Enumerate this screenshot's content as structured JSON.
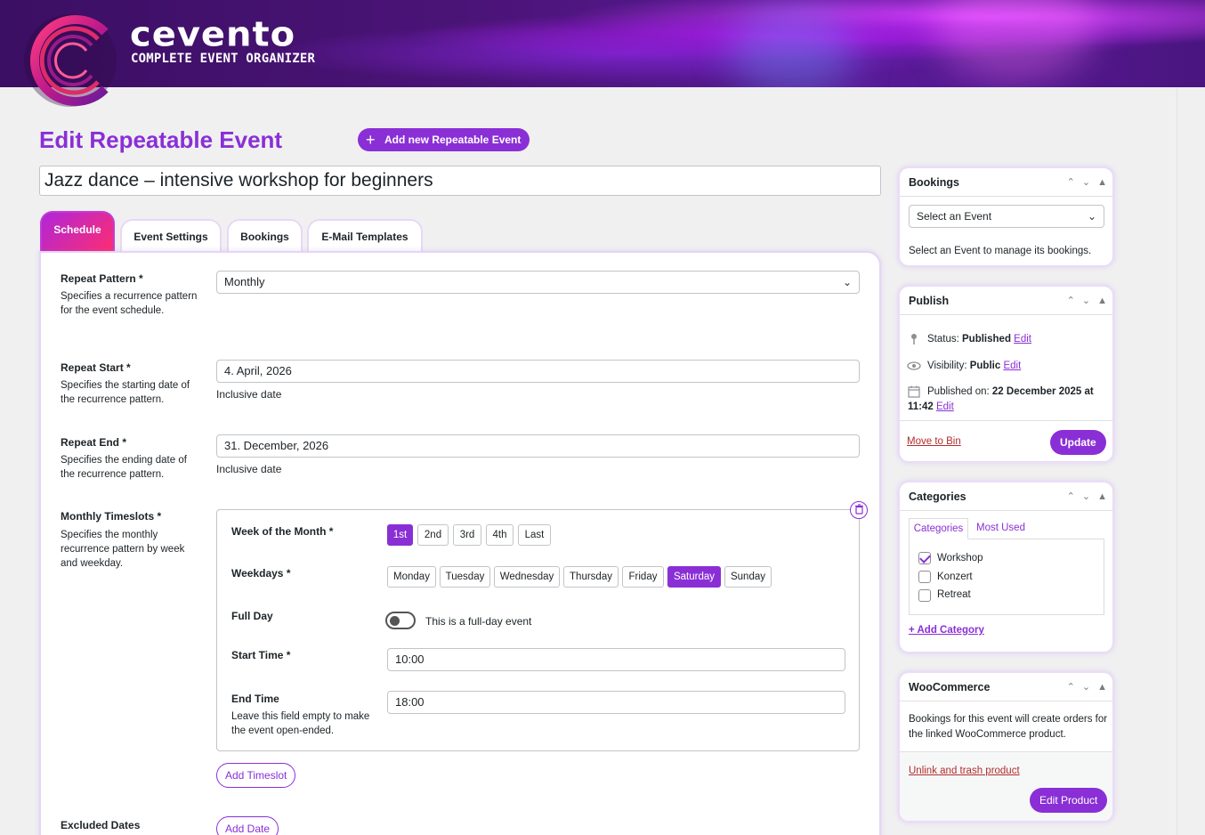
{
  "brand": {
    "name": "cevento",
    "tagline": "COMPLETE EVENT ORGANIZER"
  },
  "colors": {
    "accent": "#8a2fd6",
    "tab_gradient_start": "#b026d9",
    "tab_gradient_end": "#ff2d6f",
    "danger": "#b32d2e"
  },
  "page": {
    "title": "Edit Repeatable Event",
    "add_new_label": "Add new Repeatable Event",
    "event_title": "Jazz dance – intensive workshop for beginners"
  },
  "tabs": [
    {
      "label": "Schedule",
      "active": true
    },
    {
      "label": "Event Settings"
    },
    {
      "label": "Bookings"
    },
    {
      "label": "E-Mail Templates"
    }
  ],
  "schedule": {
    "repeat_pattern": {
      "label": "Repeat Pattern *",
      "desc": "Specifies a recurrence pattern for the event schedule.",
      "value": "Monthly"
    },
    "repeat_start": {
      "label": "Repeat Start *",
      "desc": "Specifies the starting date of the recurrence pattern.",
      "value": "4. April, 2026",
      "hint": "Inclusive date"
    },
    "repeat_end": {
      "label": "Repeat End *",
      "desc": "Specifies the ending date of the recurrence pattern.",
      "value": "31. December, 2026",
      "hint": "Inclusive date"
    },
    "monthly_timeslots": {
      "label": "Monthly Timeslots *",
      "desc": "Specifies the monthly recurrence pattern by week and weekday.",
      "week_label": "Week of the Month *",
      "weeks": [
        "1st",
        "2nd",
        "3rd",
        "4th",
        "Last"
      ],
      "selected_week": "1st",
      "weekdays_label": "Weekdays *",
      "weekdays": [
        "Monday",
        "Tuesday",
        "Wednesday",
        "Thursday",
        "Friday",
        "Saturday",
        "Sunday"
      ],
      "selected_weekday": "Saturday",
      "full_day_label": "Full Day",
      "full_day_text": "This is a full-day event",
      "start_time_label": "Start Time *",
      "start_time": "10:00",
      "end_time_label": "End Time",
      "end_time_desc": "Leave this field empty to make the event open-ended.",
      "end_time": "18:00",
      "add_timeslot_label": "Add Timeslot"
    },
    "excluded_dates": {
      "label": "Excluded Dates",
      "add_date_label": "Add Date"
    }
  },
  "sidebar": {
    "bookings": {
      "title": "Bookings",
      "select_placeholder": "Select an Event",
      "help": "Select an Event to manage its bookings."
    },
    "publish": {
      "title": "Publish",
      "status_label": "Status:",
      "status_value": "Published",
      "visibility_label": "Visibility:",
      "visibility_value": "Public",
      "published_label": "Published on:",
      "published_value": "22 December 2025 at 11:42",
      "edit_label": "Edit",
      "move_to_bin": "Move to Bin",
      "update_label": "Update"
    },
    "categories": {
      "title": "Categories",
      "tab_all": "Categories",
      "tab_used": "Most Used",
      "items": [
        {
          "label": "Workshop",
          "checked": true
        },
        {
          "label": "Konzert",
          "checked": false
        },
        {
          "label": "Retreat",
          "checked": false
        }
      ],
      "add_label": "+ Add Category"
    },
    "woocommerce": {
      "title": "WooCommerce",
      "text": "Bookings for this event will create orders for the linked WooCommerce product.",
      "unlink_label": "Unlink and trash product",
      "edit_label": "Edit Product"
    }
  }
}
